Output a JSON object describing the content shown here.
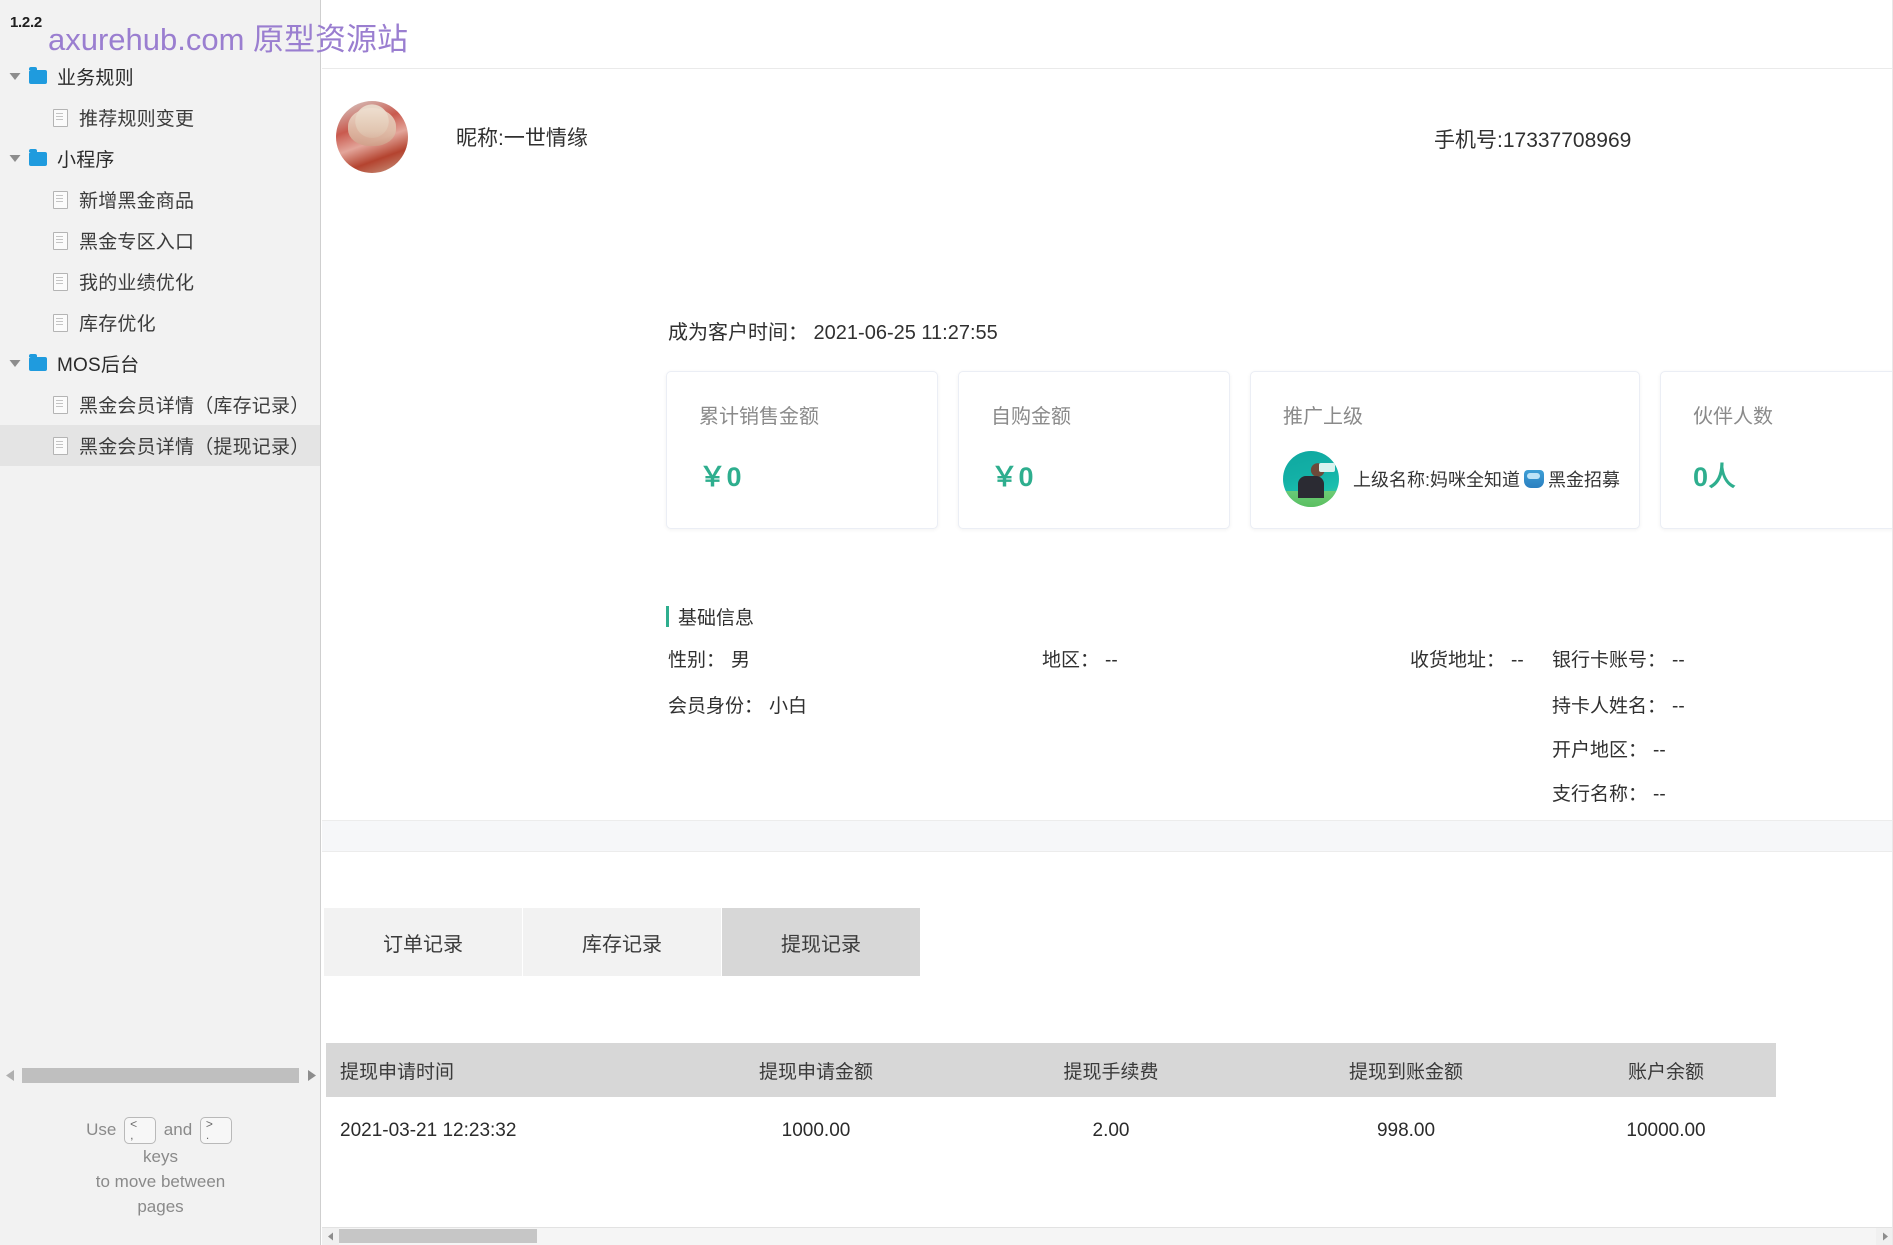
{
  "sidebar": {
    "version": "1.2.2",
    "tree": [
      {
        "type": "folder",
        "label": "业务规则",
        "expanded": true,
        "depth": 0,
        "selected": false
      },
      {
        "type": "page",
        "label": "推荐规则变更",
        "depth": 1,
        "selected": false
      },
      {
        "type": "folder",
        "label": "小程序",
        "expanded": true,
        "depth": 0,
        "selected": false
      },
      {
        "type": "page",
        "label": "新增黑金商品",
        "depth": 1,
        "selected": false
      },
      {
        "type": "page",
        "label": "黑金专区入口",
        "depth": 1,
        "selected": false
      },
      {
        "type": "page",
        "label": "我的业绩优化",
        "depth": 1,
        "selected": false
      },
      {
        "type": "page",
        "label": "库存优化",
        "depth": 1,
        "selected": false
      },
      {
        "type": "folder",
        "label": "MOS后台",
        "expanded": true,
        "depth": 0,
        "selected": false
      },
      {
        "type": "page",
        "label": "黑金会员详情（库存记录）",
        "depth": 1,
        "selected": false
      },
      {
        "type": "page",
        "label": "黑金会员详情（提现记录）",
        "depth": 1,
        "selected": true
      }
    ],
    "help": {
      "use": "Use",
      "and": "and",
      "key_prev_top": "<",
      "key_prev_bottom": ",",
      "key_next_top": ">",
      "key_next_bottom": ".",
      "line2": "keys",
      "line3": "to move between",
      "line4": "pages"
    }
  },
  "watermark": "axurehub.com 原型资源站",
  "profile": {
    "nickname": "昵称:一世情缘",
    "phone": "手机号:17337708969",
    "customer_time": "成为客户时间： 2021-06-25 11:27:55",
    "avatar_icon": "user-avatar-image"
  },
  "cards": [
    {
      "title": "累计销售金额",
      "value": "￥0",
      "kind": "amount"
    },
    {
      "title": "自购金额",
      "value": "￥0",
      "kind": "amount"
    },
    {
      "title": "推广上级",
      "value": "上级名称:妈咪全知道",
      "value_suffix": "黑金招募",
      "kind": "parent"
    },
    {
      "title": "伙伴人数",
      "value": "0人",
      "kind": "amount"
    },
    {
      "title": "",
      "value": "",
      "kind": "cut-off"
    }
  ],
  "base_info": {
    "section_title": "基础信息",
    "items": [
      {
        "label": "性别：",
        "value": "男",
        "col": 0,
        "row": 0
      },
      {
        "label": "地区：",
        "value": "--",
        "col": 1,
        "row": 0
      },
      {
        "label": "收货地址：",
        "value": "--",
        "col": 2,
        "row": 0
      },
      {
        "label": "银行卡账号：",
        "value": "--",
        "col": 3,
        "row": 0
      },
      {
        "label": "会员身份：",
        "value": "小白",
        "col": 0,
        "row": 1
      },
      {
        "label": "持卡人姓名：",
        "value": "--",
        "col": 3,
        "row": 1
      },
      {
        "label": "开户地区：",
        "value": "--",
        "col": 3,
        "row": 2
      },
      {
        "label": "支行名称：",
        "value": "--",
        "col": 3,
        "row": 3
      }
    ]
  },
  "tabs": [
    {
      "label": "订单记录",
      "active": false
    },
    {
      "label": "库存记录",
      "active": false
    },
    {
      "label": "提现记录",
      "active": true
    }
  ],
  "table": {
    "columns": [
      "提现申请时间",
      "提现申请金额",
      "提现手续费",
      "提现到账金额",
      "账户余额"
    ],
    "rows": [
      [
        "2021-03-21 12:23:32",
        "1000.00",
        "2.00",
        "998.00",
        "10000.00"
      ]
    ]
  },
  "colors": {
    "accent_green": "#2eae8e",
    "folder_blue": "#1f9bde",
    "watermark_purple": "#9a7ed0",
    "tab_active_bg": "#d7d7d7",
    "table_header_bg": "#d7d7d7"
  }
}
